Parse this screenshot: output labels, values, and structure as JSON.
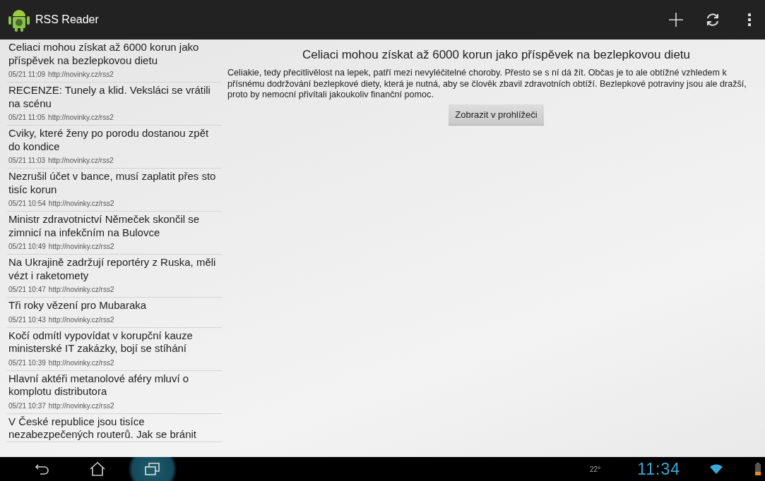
{
  "app_bar": {
    "title": "RSS Reader"
  },
  "articles": [
    {
      "title": "Celiaci mohou získat až 6000 korun jako příspěvek na bezlepkovou dietu",
      "date": "05/21 11:09",
      "source": "http://novinky.cz/rss2"
    },
    {
      "title": "RECENZE: Tunely a klid. Veksláci se vrátili na scénu",
      "date": "05/21 11:05",
      "source": "http://novinky.cz/rss2"
    },
    {
      "title": "Cviky, které ženy po porodu dostanou zpět do kondice",
      "date": "05/21 11:03",
      "source": "http://novinky.cz/rss2"
    },
    {
      "title": "Nezrušil účet v bance, musí zaplatit přes sto tisíc korun",
      "date": "05/21 10:54",
      "source": "http://novinky.cz/rss2"
    },
    {
      "title": "Ministr zdravotnictví Němeček skončil se zimnicí na infekčním na Bulovce",
      "date": "05/21 10:49",
      "source": "http://novinky.cz/rss2"
    },
    {
      "title": "Na Ukrajině zadržují reportéry z Ruska, měli vézt i raketomety",
      "date": "05/21 10:47",
      "source": "http://novinky.cz/rss2"
    },
    {
      "title": "Tři roky vězení pro Mubaraka",
      "date": "05/21 10:43",
      "source": "http://novinky.cz/rss2"
    },
    {
      "title": "Kočí odmítl vypovídat v korupční kauze ministerské IT zakázky, bojí se stíhání",
      "date": "05/21 10:39",
      "source": "http://novinky.cz/rss2"
    },
    {
      "title": "Hlavní aktéři metanolové aféry mluví o komplotu distributora",
      "date": "05/21 10:37",
      "source": "http://novinky.cz/rss2"
    },
    {
      "title": "V České republice jsou tisíce nezabezpečených routerů. Jak se bránit"
    }
  ],
  "detail": {
    "headline": "Celiaci mohou získat až 6000 korun jako příspěvek na bezlepkovou dietu",
    "body": "Celiakie, tedy přecitlivělost na lepek, patří mezi nevyléčitelné choroby. Přesto se s ní dá žít. Občas je to ale obtížné vzhledem k přísnému dodržování bezlepkové diety, která je nutná, aby se člověk zbavil zdravotních obtíží. Bezlepkové potraviny jsou ale dražší, proto by nemocní přivítali jakoukoliv finanční pomoc.",
    "button": "Zobrazit v prohlížeči"
  },
  "nav_buttons": [
    {
      "kind": "back",
      "selected": false
    },
    {
      "kind": "home",
      "selected": false
    },
    {
      "kind": "recents",
      "selected": true
    }
  ],
  "status": {
    "temperature": "22°",
    "clock": "11:34"
  }
}
